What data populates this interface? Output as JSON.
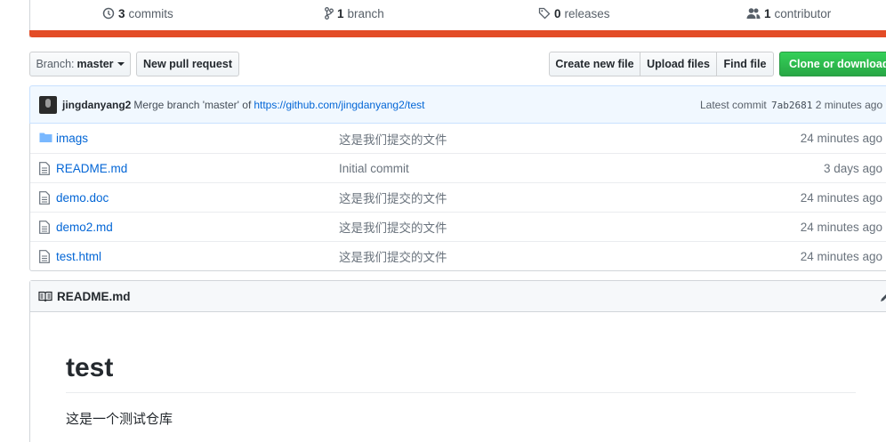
{
  "stats": {
    "commits": {
      "count": "3",
      "label": "commits"
    },
    "branch": {
      "count": "1",
      "label": "branch"
    },
    "releases": {
      "count": "0",
      "label": "releases"
    },
    "contributors": {
      "count": "1",
      "label": "contributor"
    },
    "accent_color": "#e34c26"
  },
  "toolbar": {
    "branch_prefix": "Branch:",
    "branch_name": "master",
    "new_pull_request": "New pull request",
    "create_new_file": "Create new file",
    "upload_files": "Upload files",
    "find_file": "Find file",
    "clone_or_download": "Clone or download"
  },
  "commit": {
    "author": "jingdanyang2",
    "message": "Merge branch 'master' of",
    "link": "https://github.com/jingdanyang2/test",
    "latest_label": "Latest commit",
    "sha": "7ab2681",
    "age": "2 minutes ago"
  },
  "files": [
    {
      "type": "folder-icon",
      "name": "imags",
      "message": "这是我们提交的文件",
      "age": "24 minutes ago"
    },
    {
      "type": "file-icon",
      "name": "README.md",
      "message": "Initial commit",
      "age": "3 days ago"
    },
    {
      "type": "file-icon",
      "name": "demo.doc",
      "message": "这是我们提交的文件",
      "age": "24 minutes ago"
    },
    {
      "type": "file-icon",
      "name": "demo2.md",
      "message": "这是我们提交的文件",
      "age": "24 minutes ago"
    },
    {
      "type": "file-icon",
      "name": "test.html",
      "message": "这是我们提交的文件",
      "age": "24 minutes ago"
    }
  ],
  "readme": {
    "filename": "README.md",
    "heading": "test",
    "body": "这是一个测试仓库"
  }
}
